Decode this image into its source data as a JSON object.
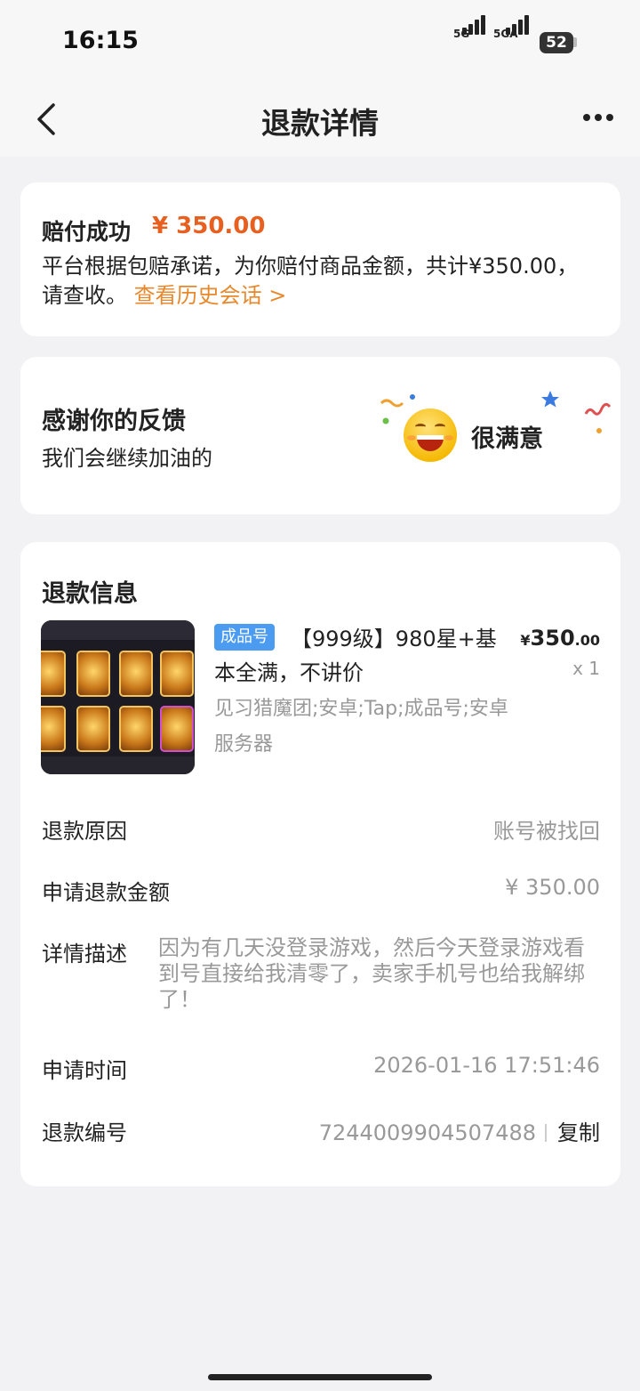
{
  "status_bar": {
    "time": "16:15",
    "signal1": "5G",
    "signal2": "5GA",
    "battery": "52"
  },
  "nav": {
    "title": "退款详情"
  },
  "compensation": {
    "title": "赔付成功",
    "amount": "¥ 350.00",
    "desc": "平台根据包赔承诺，为你赔付商品金额，共计¥350.00，请查收。",
    "link": "查看历史会话 >"
  },
  "feedback": {
    "title": "感谢你的反馈",
    "subtitle": "我们会继续加油的",
    "rating_label": "很满意",
    "icon": "smiley-face-icon"
  },
  "refund_info": {
    "heading": "退款信息",
    "product": {
      "tag": "成品号",
      "name": "【999级】980星+基本全满，不讲价",
      "attrs": "见习猎魔团;安卓;Tap;成品号;安卓服务器",
      "price_symbol": "¥",
      "price_int": "350",
      "price_dec": ".00",
      "quantity": "x 1"
    },
    "rows": {
      "reason_label": "退款原因",
      "reason_value": "账号被找回",
      "amount_label": "申请退款金额",
      "amount_value": "¥ 350.00",
      "detail_label": "详情描述",
      "detail_value": "因为有几天没登录游戏，然后今天登录游戏看到号直接给我清零了，卖家手机号也给我解绑了！",
      "time_label": "申请时间",
      "time_value": "2026-01-16 17:51:46",
      "no_label": "退款编号",
      "no_value": "7244009904507488",
      "copy_label": "复制"
    }
  },
  "colors": {
    "accent_orange": "#e8601f",
    "link_orange": "#e8882c",
    "tag_blue": "#4b9bf0"
  }
}
